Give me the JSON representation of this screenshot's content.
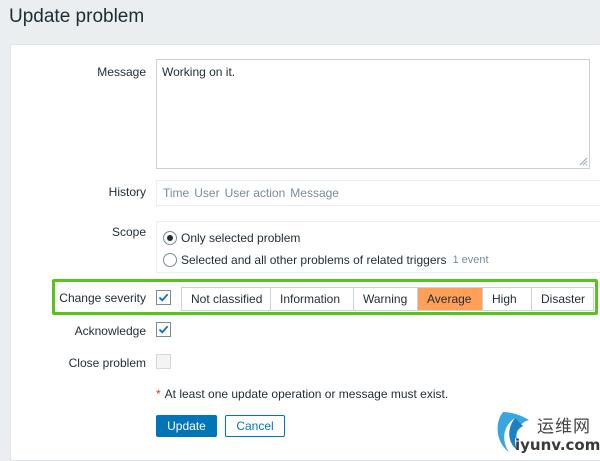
{
  "page": {
    "title": "Update problem"
  },
  "form": {
    "message": {
      "label": "Message",
      "value": "Working on it."
    },
    "history": {
      "label": "History",
      "columns": [
        "Time",
        "User",
        "User action",
        "Message"
      ]
    },
    "scope": {
      "label": "Scope",
      "options": [
        {
          "label": "Only selected problem",
          "checked": true
        },
        {
          "label": "Selected and all other problems of related triggers",
          "checked": false,
          "suffix": "1 event"
        }
      ]
    },
    "change_severity": {
      "label": "Change severity",
      "checked": true,
      "levels": [
        "Not classified",
        "Information",
        "Warning",
        "Average",
        "High",
        "Disaster"
      ],
      "selected": "Average",
      "selected_color": "#ffa059"
    },
    "acknowledge": {
      "label": "Acknowledge",
      "checked": true
    },
    "close_problem": {
      "label": "Close problem",
      "checked": false,
      "disabled": true
    },
    "required_note": "At least one update operation or message must exist.",
    "required_marker": "*",
    "buttons": {
      "update": "Update",
      "cancel": "Cancel"
    }
  },
  "colors": {
    "accent": "#0275b8",
    "highlight_outline": "#58c31e",
    "severity_average": "#ffa059"
  },
  "watermark": {
    "cn": "运维网",
    "en": "iyunv.com"
  }
}
